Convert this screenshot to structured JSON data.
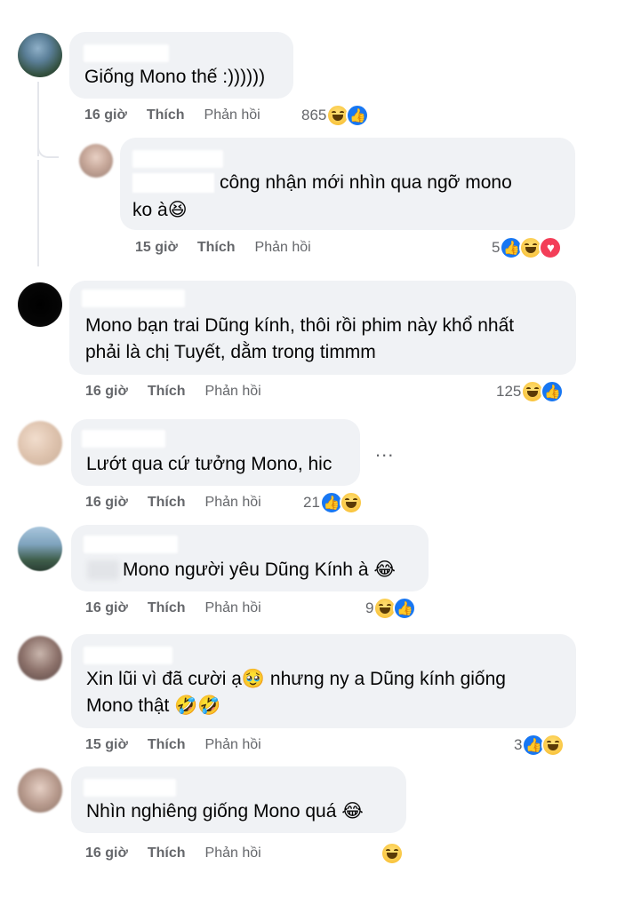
{
  "comments": [
    {
      "text": "Giống Mono thế :))))))",
      "time": "16 giờ",
      "like": "Thích",
      "reply": "Phản hồi",
      "count": "865",
      "reactions": [
        "haha-icon",
        "like-icon"
      ]
    },
    {
      "text_line1": "công nhận mới nhìn qua ngỡ mono",
      "text_line2": "ko à😆",
      "time": "15 giờ",
      "like": "Thích",
      "reply": "Phản hồi",
      "count": "5",
      "reactions": [
        "like-icon",
        "haha-icon",
        "love-icon"
      ]
    },
    {
      "text_line1": "Mono bạn trai Dũng kính, thôi rồi phim này khổ nhất",
      "text_line2": "phải là chị Tuyết, dằm trong timmm",
      "time": "16 giờ",
      "like": "Thích",
      "reply": "Phản hồi",
      "count": "125",
      "reactions": [
        "haha-icon",
        "like-icon"
      ]
    },
    {
      "text": "Lướt qua cứ tưởng Mono, hic",
      "time": "16 giờ",
      "like": "Thích",
      "reply": "Phản hồi",
      "count": "21",
      "reactions": [
        "like-icon",
        "haha-icon"
      ],
      "more": "..."
    },
    {
      "text": "Mono người yêu Dũng Kính à 😂",
      "time": "16 giờ",
      "like": "Thích",
      "reply": "Phản hồi",
      "count": "9",
      "reactions": [
        "haha-icon",
        "like-icon"
      ]
    },
    {
      "text_line1a": "Xin lũi vì đã cười ạ",
      "text_line1b": "🥹 nhưng ny a Dũng kính giống",
      "text_line2": "Mono thật 🤣🤣",
      "time": "15 giờ",
      "like": "Thích",
      "reply": "Phản hồi",
      "count": "3",
      "reactions": [
        "like-icon",
        "haha-icon"
      ]
    },
    {
      "text": "Nhìn nghiêng giống Mono quá 😂",
      "time": "16 giờ",
      "like": "Thích",
      "reply": "Phản hồi",
      "count": "",
      "reactions": [
        "haha-icon"
      ]
    }
  ]
}
